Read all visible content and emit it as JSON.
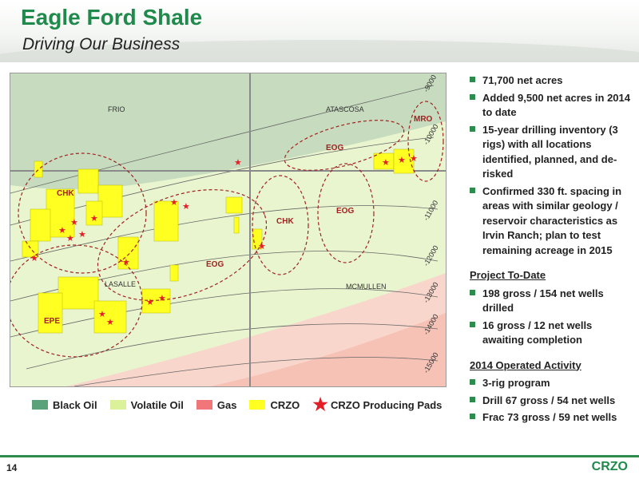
{
  "header": {
    "title": "Eagle Ford Shale",
    "subtitle": "Driving Our Business"
  },
  "map": {
    "counties": [
      "FRIO",
      "ATASCOSA",
      "LASALLE",
      "MCMULLEN"
    ],
    "operators": [
      "CHK",
      "EPE",
      "EOG",
      "EOG",
      "CHK",
      "EOG",
      "EOG",
      "MRO"
    ],
    "contours": [
      "-9000",
      "-10000",
      "-11000",
      "-12000",
      "-13000",
      "-14000",
      "-15000"
    ],
    "colors": {
      "black_oil": "#5aa27a",
      "volatile_oil": "#dcf29a",
      "gas": "#f1767a",
      "crzo": "#ffff22",
      "pads": "#e41e26"
    }
  },
  "legend": {
    "black_oil": "Black Oil",
    "volatile_oil": "Volatile Oil",
    "gas": "Gas",
    "crzo": "CRZO",
    "pads": "CRZO Producing Pads"
  },
  "bullets": [
    "71,700 net acres",
    "Added 9,500 net acres in 2014 to date",
    "15-year drilling inventory (3 rigs) with all locations identified, planned, and de-risked",
    "Confirmed 330 ft. spacing in areas with similar geology / reservoir characteristics as Irvin Ranch; plan to test remaining acreage in 2015"
  ],
  "project": {
    "heading": "Project To-Date",
    "items": [
      "198 gross / 154 net wells drilled",
      "16 gross / 12 net wells awaiting completion"
    ]
  },
  "activity": {
    "heading": "2014 Operated Activity",
    "items": [
      "3-rig program",
      "Drill 67 gross / 54 net wells",
      "Frac 73 gross / 59 net wells"
    ]
  },
  "footer": {
    "page": "14",
    "logo": "CRZO"
  }
}
